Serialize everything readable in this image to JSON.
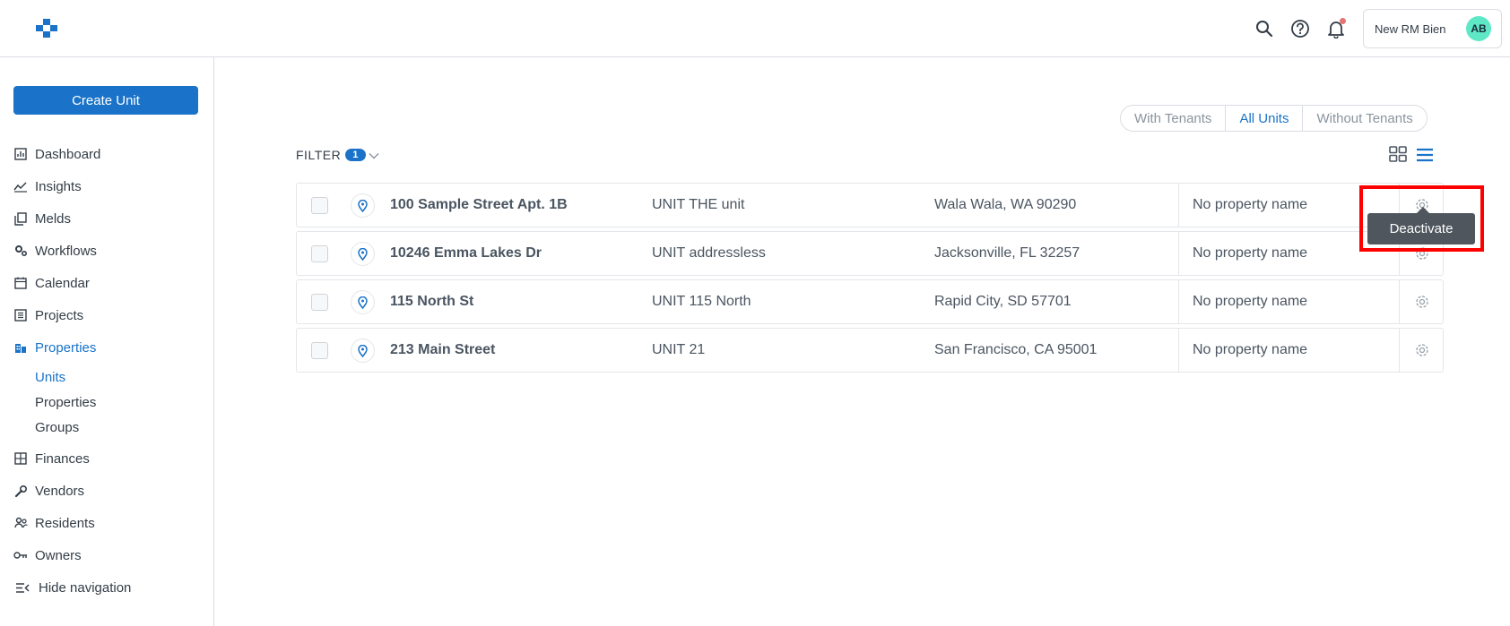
{
  "header": {
    "user_name": "New RM Bien",
    "user_initials": "AB",
    "icons": [
      "logo-icon",
      "search-icon",
      "help-icon",
      "bell-icon"
    ]
  },
  "sidebar": {
    "create_label": "Create Unit",
    "items": [
      {
        "label": "Dashboard",
        "icon": "dashboard-icon"
      },
      {
        "label": "Insights",
        "icon": "insights-icon"
      },
      {
        "label": "Melds",
        "icon": "melds-icon"
      },
      {
        "label": "Workflows",
        "icon": "workflows-icon"
      },
      {
        "label": "Calendar",
        "icon": "calendar-icon"
      },
      {
        "label": "Projects",
        "icon": "projects-icon"
      },
      {
        "label": "Properties",
        "icon": "properties-icon",
        "active": true
      },
      {
        "label": "Finances",
        "icon": "finances-icon"
      },
      {
        "label": "Vendors",
        "icon": "vendors-icon"
      },
      {
        "label": "Residents",
        "icon": "residents-icon"
      },
      {
        "label": "Owners",
        "icon": "owners-icon"
      },
      {
        "label": "Hide navigation",
        "icon": "hide-nav-icon"
      }
    ],
    "sub_items": [
      {
        "label": "Units",
        "active": true
      },
      {
        "label": "Properties"
      },
      {
        "label": "Groups"
      }
    ]
  },
  "main": {
    "segments": [
      {
        "label": "With Tenants"
      },
      {
        "label": "All Units",
        "active": true
      },
      {
        "label": "Without Tenants"
      }
    ],
    "filter_label": "FILTER",
    "filter_count": "1",
    "rows": [
      {
        "address": "100 Sample Street Apt. 1B",
        "unit": "UNIT THE unit",
        "city": "Wala Wala, WA 90290",
        "property": "No property name"
      },
      {
        "address": "10246 Emma Lakes Dr",
        "unit": "UNIT addressless",
        "city": "Jacksonville, FL 32257",
        "property": "No property name"
      },
      {
        "address": "115 North St",
        "unit": "UNIT 115 North",
        "city": "Rapid City, SD 57701",
        "property": "No property name"
      },
      {
        "address": "213 Main Street",
        "unit": "UNIT 21",
        "city": "San Francisco, CA 95001",
        "property": "No property name"
      }
    ],
    "tooltip": "Deactivate"
  },
  "colors": {
    "accent": "#1a73c8",
    "avatar": "#5ee8c5",
    "highlight": "#ff0000"
  }
}
